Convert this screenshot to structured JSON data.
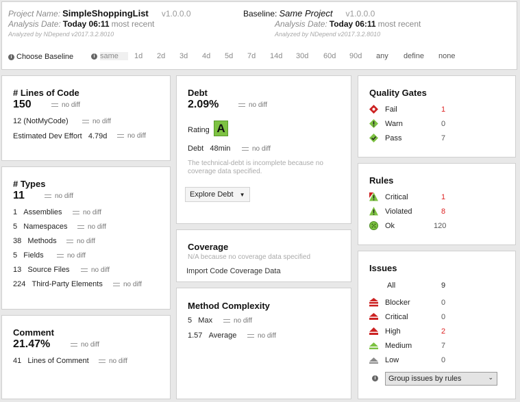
{
  "header": {
    "project_label": "Project Name:",
    "project_name": "SimpleShoppingList",
    "project_version": "v1.0.0.0",
    "analysis_label": "Analysis Date:",
    "analysis_date": "Today 06:11",
    "analysis_suffix": "most recent",
    "analyzed_by": "Analyzed by NDepend v2017.3.2.8010",
    "baseline_label": "Baseline:",
    "baseline_name": "Same Project",
    "baseline_version": "v1.0.0.0",
    "baseline_analysis_label": "Analysis Date:",
    "baseline_analysis_date": "Today 06:11",
    "baseline_analysis_suffix": "most recent",
    "baseline_analyzed_by": "Analyzed by NDepend v2017.3.2.8010"
  },
  "baseline": {
    "label": "Choose Baseline",
    "options": [
      "same",
      "1d",
      "2d",
      "3d",
      "4d",
      "5d",
      "7d",
      "14d",
      "30d",
      "60d",
      "90d",
      "any",
      "define",
      "none"
    ]
  },
  "loc": {
    "title": "# Lines of Code",
    "value": "150",
    "diff": "no diff",
    "notmycode": "12  (NotMyCode)",
    "notmycode_diff": "no diff",
    "effort_label": "Estimated Dev Effort",
    "effort_value": "4.79d",
    "effort_diff": "no diff"
  },
  "types": {
    "title": "# Types",
    "value": "11",
    "diff": "no diff",
    "rows": [
      {
        "count": "1",
        "label": "Assemblies",
        "diff": "no diff"
      },
      {
        "count": "5",
        "label": "Namespaces",
        "diff": "no diff"
      },
      {
        "count": "38",
        "label": "Methods",
        "diff": "no diff"
      },
      {
        "count": "5",
        "label": "Fields",
        "diff": "no diff"
      },
      {
        "count": "13",
        "label": "Source Files",
        "diff": "no diff"
      },
      {
        "count": "224",
        "label": "Third-Party Elements",
        "diff": "no diff"
      }
    ]
  },
  "comment": {
    "title": "Comment",
    "value": "21.47%",
    "diff": "no diff",
    "lines": "41",
    "lines_label": "Lines of Comment",
    "lines_diff": "no diff"
  },
  "debt": {
    "title": "Debt",
    "value": "2.09%",
    "diff": "no diff",
    "rating_label": "Rating",
    "rating": "A",
    "debt_label": "Debt",
    "debt_value": "48min",
    "debt_diff": "no diff",
    "note": "The technical-debt is incomplete because no coverage data specified.",
    "explore_label": "Explore Debt"
  },
  "coverage": {
    "title": "Coverage",
    "note": "N/A because no coverage data specified",
    "import_label": "Import Code Coverage Data"
  },
  "complexity": {
    "title": "Method Complexity",
    "max": "5",
    "max_label": "Max",
    "max_diff": "no diff",
    "avg": "1.57",
    "avg_label": "Average",
    "avg_diff": "no diff"
  },
  "quality_gates": {
    "title": "Quality Gates",
    "fail_label": "Fail",
    "fail_count": "1",
    "warn_label": "Warn",
    "warn_count": "0",
    "pass_label": "Pass",
    "pass_count": "7"
  },
  "rules": {
    "title": "Rules",
    "critical_label": "Critical",
    "critical_count": "1",
    "violated_label": "Violated",
    "violated_count": "8",
    "ok_label": "Ok",
    "ok_count": "120"
  },
  "issues": {
    "title": "Issues",
    "all_label": "All",
    "all_count": "9",
    "blocker_label": "Blocker",
    "blocker_count": "0",
    "critical_label": "Critical",
    "critical_count": "0",
    "high_label": "High",
    "high_count": "2",
    "medium_label": "Medium",
    "medium_count": "7",
    "low_label": "Low",
    "low_count": "0",
    "group_label": "Group issues by rules"
  },
  "colors": {
    "red": "#cc2222",
    "green": "#7dc242",
    "yellow": "#e8c21f"
  }
}
